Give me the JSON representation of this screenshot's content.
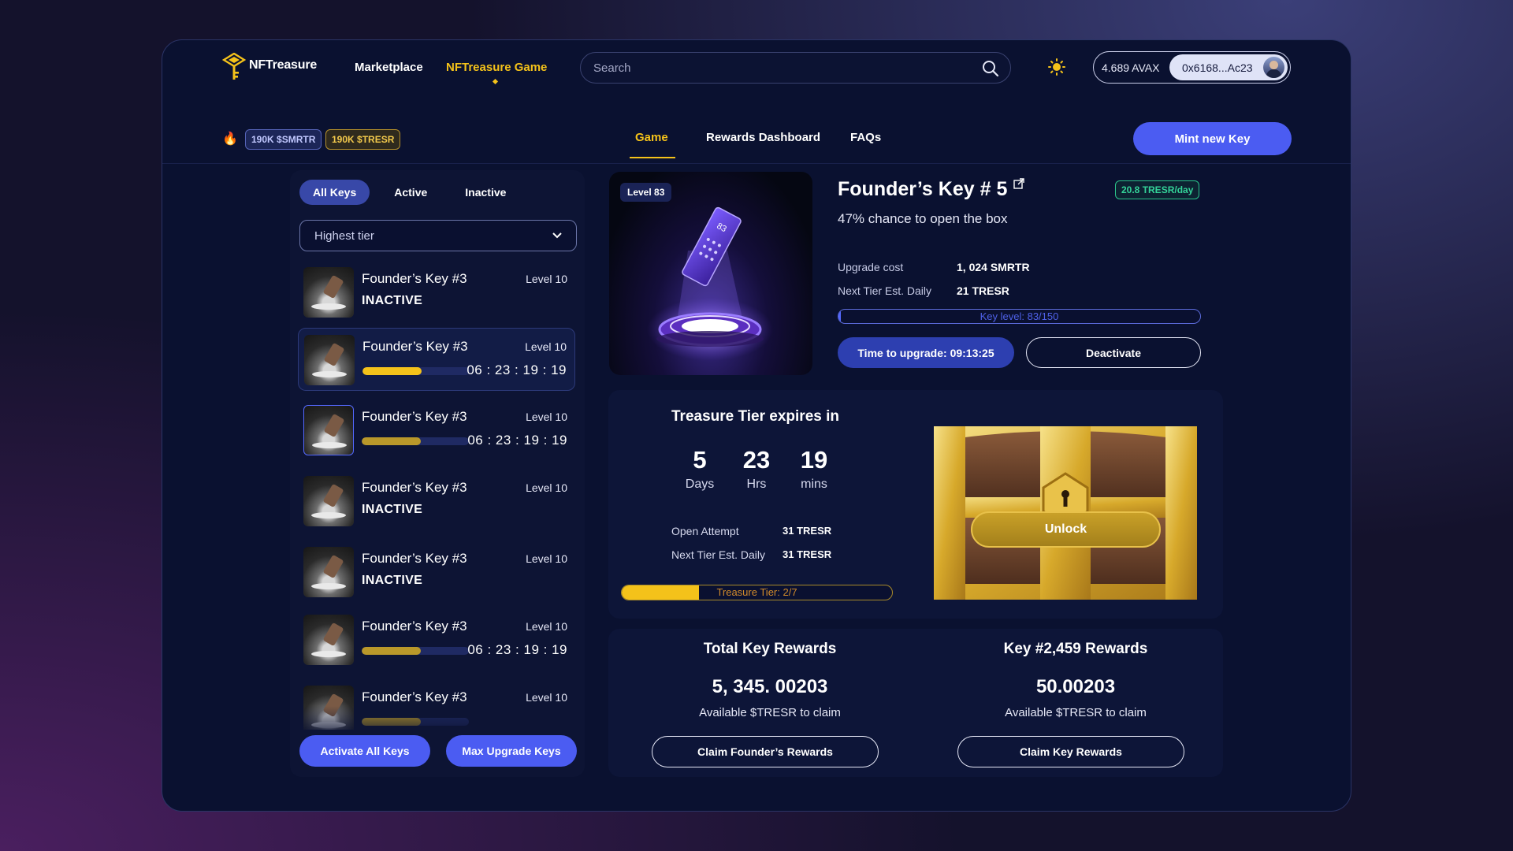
{
  "header": {
    "logo_text": "NFTreasure",
    "nav": [
      {
        "label": "Marketplace"
      },
      {
        "label": "NFTreasure Game"
      }
    ],
    "search_placeholder": "Search",
    "wallet_balance": "4.689 AVAX",
    "wallet_address": "0x6168...Ac23"
  },
  "subbar": {
    "tokens": [
      {
        "label": "190K $SMRTR"
      },
      {
        "label": "190K $TRESR"
      }
    ],
    "tabs": [
      {
        "label": "Game"
      },
      {
        "label": "Rewards Dashboard"
      },
      {
        "label": "FAQs"
      }
    ],
    "mint_label": "Mint new Key"
  },
  "keys_panel": {
    "filters": [
      {
        "label": "All Keys"
      },
      {
        "label": "Active"
      },
      {
        "label": "Inactive"
      }
    ],
    "sort_selected": "Highest tier",
    "keys": [
      {
        "name": "Founder’s Key #3",
        "level": "Level 10",
        "status": "INACTIVE",
        "timer": "",
        "progress": 0
      },
      {
        "name": "Founder’s Key #3",
        "level": "Level 10",
        "status": "",
        "timer": "06 : 23 : 19 : 19",
        "progress": 0.55
      },
      {
        "name": "Founder’s Key #3",
        "level": "Level 10",
        "status": "",
        "timer": "06 : 23 : 19 : 19",
        "progress": 0.55
      },
      {
        "name": "Founder’s Key #3",
        "level": "Level 10",
        "status": "INACTIVE",
        "timer": "",
        "progress": 0
      },
      {
        "name": "Founder’s Key #3",
        "level": "Level 10",
        "status": "INACTIVE",
        "timer": "",
        "progress": 0
      },
      {
        "name": "Founder’s Key #3",
        "level": "Level 10",
        "status": "",
        "timer": "06 : 23 : 19 : 19",
        "progress": 0.55
      },
      {
        "name": "Founder’s Key #3",
        "level": "Level 10",
        "status": "",
        "timer": "",
        "progress": 0.55
      }
    ],
    "activate_all_label": "Activate All Keys",
    "max_upgrade_label": "Max Upgrade Keys"
  },
  "key_detail": {
    "level_badge": "Level 83",
    "name": "Founder’s Key # 5",
    "rate": "20.8 TRESR/day",
    "chance": "47% chance to open the box",
    "upgrade_cost_label": "Upgrade cost",
    "upgrade_cost_value": "1, 024 SMRTR",
    "next_tier_label": "Next Tier Est. Daily",
    "next_tier_value": "21 TRESR",
    "key_level_text": "Key level: 83/150",
    "key_level_progress": 0.0,
    "upgrade_timer_label": "Time to upgrade: 09:13:25",
    "deactivate_label": "Deactivate"
  },
  "treasure": {
    "title": "Treasure Tier expires in",
    "countdown": [
      {
        "value": "5",
        "unit": "Days"
      },
      {
        "value": "23",
        "unit": "Hrs"
      },
      {
        "value": "19",
        "unit": "mins"
      }
    ],
    "open_attempt_label": "Open Attempt",
    "open_attempt_value": "31 TRESR",
    "next_tier_label": "Next Tier Est. Daily",
    "next_tier_value": "31 TRESR",
    "tier_text": "Treasure Tier:  2/7",
    "tier_progress": 0.2857,
    "unlock_label": "Unlock"
  },
  "rewards": {
    "total": {
      "title": "Total Key Rewards",
      "value": "5, 345. 00203",
      "sub": "Available $TRESR to claim",
      "button": "Claim Founder’s Rewards"
    },
    "key": {
      "title": "Key #2,459 Rewards",
      "value": "50.00203",
      "sub": "Available $TRESR to claim",
      "button": "Claim Key Rewards"
    }
  },
  "colors": {
    "accent_blue": "#4b5cf2",
    "accent_gold": "#f4c21a",
    "success_green": "#34d399",
    "background": "#0a1130"
  }
}
